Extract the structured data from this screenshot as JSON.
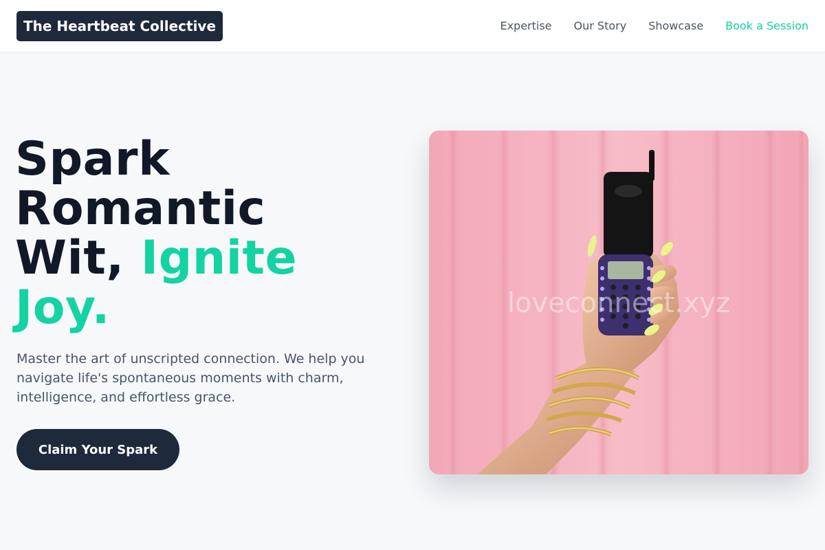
{
  "brand": {
    "name": "The Heartbeat Collective"
  },
  "nav": {
    "items": [
      "Expertise",
      "Our Story",
      "Showcase"
    ],
    "cta": "Book a Session"
  },
  "hero": {
    "title_line1": "Spark",
    "title_line2": "Romantic",
    "title_line3_a": "Wit,",
    "title_line3_b": "Ignite",
    "title_line4": "Joy.",
    "description": "Master the art of unscripted connection. We help you navigate life's spontaneous moments with charm, intelligence, and effortless grace.",
    "button": "Claim Your Spark",
    "image_watermark": "loveconnect.xyz"
  },
  "colors": {
    "dark": "#1e293b",
    "accent": "#14d3a2",
    "background": "#f7f8fa",
    "image_backdrop": "#f4b3c0"
  }
}
